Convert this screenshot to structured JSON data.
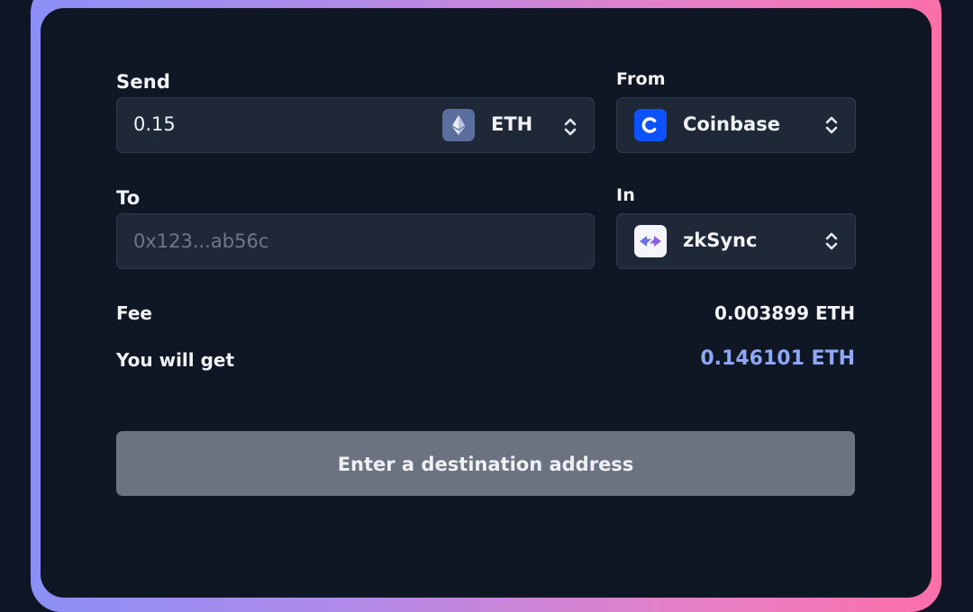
{
  "send": {
    "label": "Send",
    "amount": "0.15",
    "token": "ETH",
    "token_icon": "ethereum-icon"
  },
  "from": {
    "label": "From",
    "source": "Coinbase",
    "source_icon": "coinbase-icon"
  },
  "to": {
    "label": "To",
    "placeholder": "0x123...ab56c",
    "value": ""
  },
  "in": {
    "label": "In",
    "network": "zkSync",
    "network_icon": "zksync-icon"
  },
  "fee": {
    "label": "Fee",
    "value": "0.003899 ETH"
  },
  "receive": {
    "label": "You will get",
    "value": "0.146101 ETH"
  },
  "cta": {
    "label": "Enter a destination address"
  },
  "colors": {
    "accent_value": "#8fa8f5",
    "button_disabled": "#6b7380",
    "coinbase_blue": "#0d52ff",
    "frame_gradient_start": "#8b8ff5",
    "frame_gradient_end": "#fb6fa8"
  }
}
